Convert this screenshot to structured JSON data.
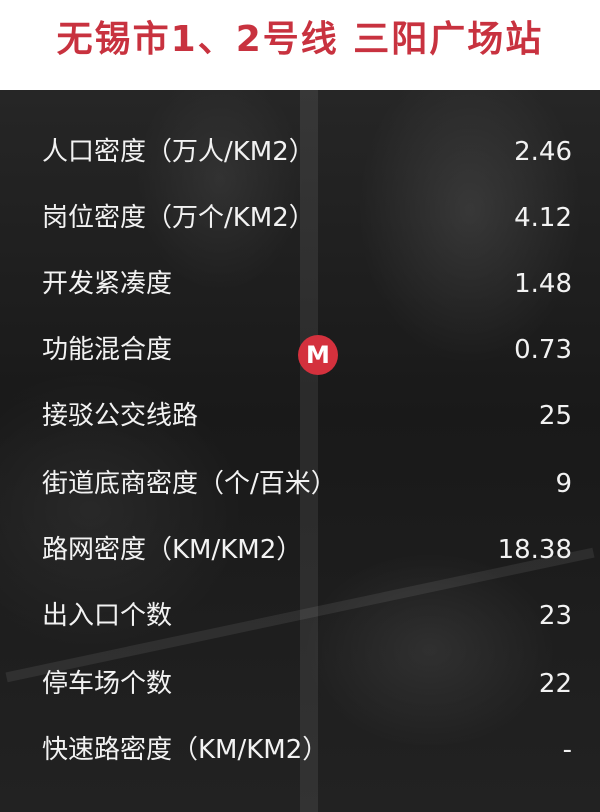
{
  "title": "无锡市1、2号线  三阳广场站",
  "metro_icon": {
    "glyph": "M",
    "icon": "metro-icon",
    "color": "#d4313d"
  },
  "rows": [
    {
      "label": "人口密度（万人/KM2）",
      "value": "2.46"
    },
    {
      "label": "岗位密度（万个/KM2）",
      "value": "4.12"
    },
    {
      "label": "开发紧凑度",
      "value": "1.48"
    },
    {
      "label": "功能混合度",
      "value": "0.73"
    },
    {
      "label": "接驳公交线路",
      "value": "25"
    },
    {
      "label": "街道底商密度（个/百米）",
      "value": "9"
    },
    {
      "label": "路网密度（KM/KM2）",
      "value": "18.38"
    },
    {
      "label": "出入口个数",
      "value": "23"
    },
    {
      "label": "停车场个数",
      "value": "22"
    },
    {
      "label": "快速路密度（KM/KM2）",
      "value": "-"
    }
  ],
  "colors": {
    "title": "#c8323f",
    "text": "#f2f2f2",
    "background": "#1b1b1b"
  }
}
